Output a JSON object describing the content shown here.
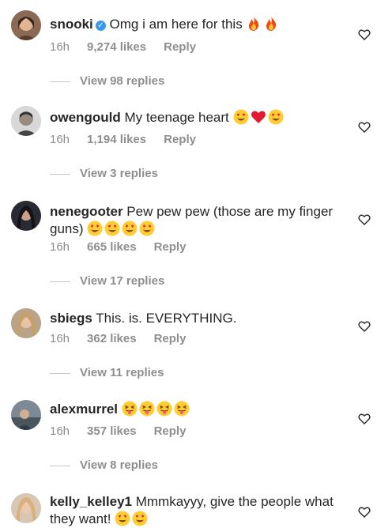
{
  "comments": [
    {
      "username": "snooki",
      "verified": true,
      "text": "Omg i am here for this",
      "emojis": [
        "fire",
        "fire"
      ],
      "time": "16h",
      "likes": "9,274 likes",
      "reply": "Reply",
      "view_replies": "View 98 replies"
    },
    {
      "username": "owengould",
      "verified": false,
      "text": "My teenage heart",
      "emojis": [
        "heart-eyes",
        "red-heart",
        "heart-eyes"
      ],
      "time": "16h",
      "likes": "1,194 likes",
      "reply": "Reply",
      "view_replies": "View 3 replies"
    },
    {
      "username": "nenegooter",
      "verified": false,
      "text": "Pew pew pew (those are my finger guns)",
      "emojis": [
        "heart-eyes",
        "heart-eyes",
        "heart-eyes",
        "heart-eyes"
      ],
      "time": "16h",
      "likes": "665 likes",
      "reply": "Reply",
      "view_replies": "View 17 replies"
    },
    {
      "username": "sbiegs",
      "verified": false,
      "text": "This. is. EVERYTHING.",
      "emojis": [],
      "time": "16h",
      "likes": "362 likes",
      "reply": "Reply",
      "view_replies": "View 11 replies"
    },
    {
      "username": "alexmurrel",
      "verified": false,
      "text": "",
      "emojis": [
        "tongue-wink",
        "tongue-wink",
        "tongue-wink",
        "tongue-wink"
      ],
      "time": "16h",
      "likes": "357 likes",
      "reply": "Reply",
      "view_replies": "View 8 replies"
    },
    {
      "username": "kelly_kelley1",
      "verified": false,
      "text": "Mmmkayyy, give the people what they want!",
      "emojis": [
        "heart-eyes",
        "heart-eyes"
      ],
      "time": "",
      "likes": "",
      "reply": "",
      "view_replies": ""
    }
  ],
  "icons": {
    "like": "heart-outline-icon",
    "verified": "verified-badge-icon"
  },
  "colors": {
    "text": "#262626",
    "muted": "#8e8e8e",
    "verified": "#3897f0",
    "divider": "#c7c7c7"
  }
}
